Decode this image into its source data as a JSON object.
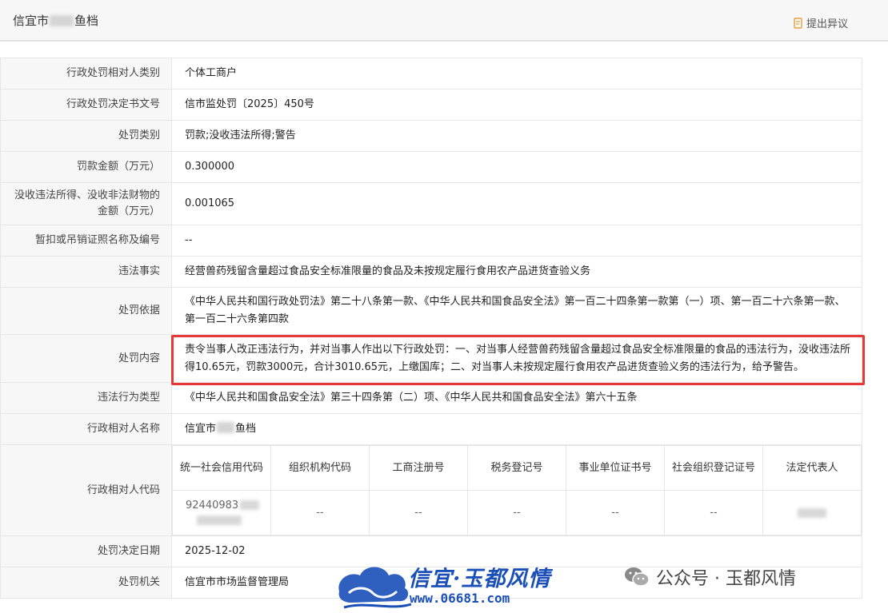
{
  "header": {
    "title_prefix": "信宜市",
    "title_suffix": "鱼档",
    "objection_label": "提出异议",
    "objection_icon": "document-edit-icon"
  },
  "rows": [
    {
      "key": "行政处罚相对人类别",
      "value": "个体工商户"
    },
    {
      "key": "行政处罚决定书文号",
      "value": "信市监处罚〔2025〕450号"
    },
    {
      "key": "处罚类别",
      "value": "罚款;没收违法所得;警告"
    },
    {
      "key": "罚款金额（万元）",
      "value": "0.300000"
    },
    {
      "key": "没收违法所得、没收非法财物的金额（万元）",
      "value": "0.001065"
    },
    {
      "key": "暂扣或吊销证照名称及编号",
      "value": "--"
    },
    {
      "key": "违法事实",
      "value": "经营兽药残留含量超过食品安全标准限量的食品及未按规定履行食用农产品进货查验义务"
    },
    {
      "key": "处罚依据",
      "value": "《中华人民共和国行政处罚法》第二十八条第一款、《中华人民共和国食品安全法》第一百二十四条第一款第（一）项、第一百二十六条第一款、第一百二十六条第四款"
    },
    {
      "key": "处罚内容",
      "value": "责令当事人改正违法行为，并对当事人作出以下行政处罚：一、对当事人经营兽药残留含量超过食品安全标准限量的食品的违法行为，没收违法所得10.65元，罚款3000元，合计3010.65元，上缴国库；二、对当事人未按规定履行食用农产品进货查验义务的违法行为，给予警告。"
    },
    {
      "key": "违法行为类型",
      "value": "《中华人民共和国食品安全法》第三十四条第（二）项、《中华人民共和国食品安全法》第六十五条"
    },
    {
      "key": "行政相对人名称",
      "value_prefix": "信宜市",
      "value_suffix": "鱼档"
    }
  ],
  "codes": {
    "key": "行政相对人代码",
    "headers": [
      "统一社会信用代码",
      "组织机构代码",
      "工商注册号",
      "税务登记号",
      "事业单位证书号",
      "社会组织登记证号",
      "法定代表人"
    ],
    "values": [
      "92440983",
      "--",
      "--",
      "--",
      "--",
      "--",
      ""
    ]
  },
  "tail_rows": [
    {
      "key": "处罚决定日期",
      "value": "2025-12-02"
    },
    {
      "key": "处罚机关",
      "value": "信宜市市场监督管理局"
    }
  ],
  "watermark": {
    "brand": "信宜·玉都风情",
    "url": "www.06681.com",
    "wechat": "公众号 · 玉都风情",
    "wechat_icon": "wechat-icon",
    "logo_icon": "cloud-logo-icon"
  }
}
